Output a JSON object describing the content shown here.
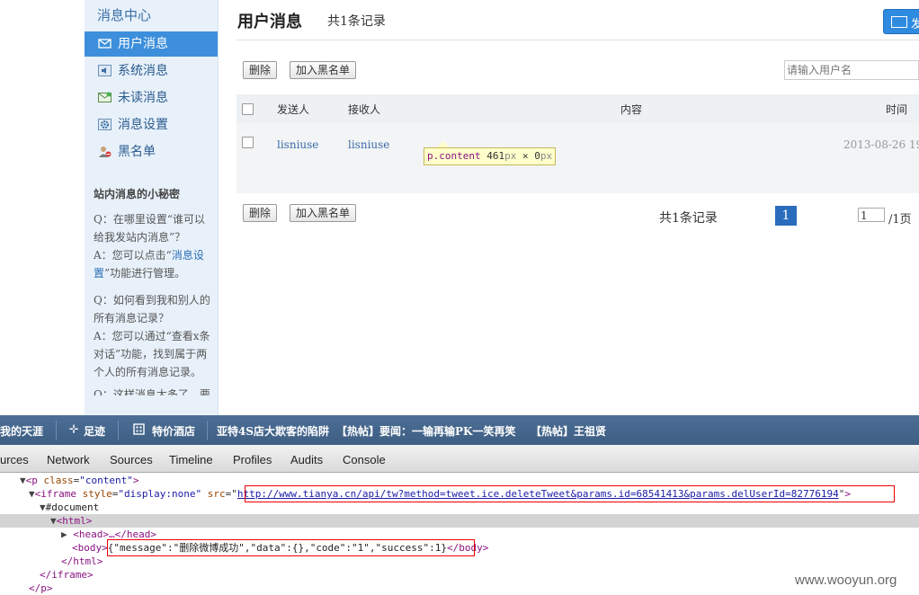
{
  "sidebar": {
    "title": "消息中心",
    "items": [
      {
        "label": "用户消息",
        "icon": "envelope-icon",
        "active": true
      },
      {
        "label": "系统消息",
        "icon": "speaker-icon"
      },
      {
        "label": "未读消息",
        "icon": "unread-mail-icon"
      },
      {
        "label": "消息设置",
        "icon": "gear-icon"
      },
      {
        "label": "黑名单",
        "icon": "user-block-icon"
      }
    ],
    "tips_title": "站内消息的小秘密",
    "tips": {
      "q1": "Q：在哪里设置“谁可以给我发站内消息”？",
      "a1_pre": "A：您可以点击“",
      "a1_link": "消息设置",
      "a1_post": "”功能进行管理。",
      "q2": "Q：如何看到我和别人的所有消息记录？",
      "a2": "A：您可以通过“查看x条对话”功能，找到属于两个人的所有消息记录。",
      "cut": "Q：这样消息太多了，要"
    }
  },
  "main": {
    "title": "用户消息",
    "count": "共1条记录",
    "compose_label": "发",
    "toolbar": {
      "delete_label": "删除",
      "blacklist_label": "加入黑名单",
      "search_placeholder": "请输入用户名"
    },
    "table": {
      "headers": {
        "sender": "发送人",
        "receiver": "接收人",
        "content": "内容",
        "time": "时间"
      },
      "rows": [
        {
          "sender": "lisniuse",
          "receiver": "lisniuse",
          "content": "",
          "time": "2013-08-26 19:"
        }
      ]
    },
    "inspect_tooltip": {
      "selector": "p.content",
      "width": "461",
      "unit_w": "px",
      "x": " × ",
      "height": "0",
      "unit_h": "px"
    },
    "pager": {
      "total": "共1条记录",
      "current": "1",
      "input": "1",
      "suffix": "/1页"
    }
  },
  "browser_bar": {
    "items": [
      "我的天涯",
      "足迹",
      "特价酒店",
      "亚特4S店大欺客的陷阱",
      "【热帖】要闻：一输再输PK一笑再笑",
      "【热帖】王祖贤"
    ]
  },
  "devtools": {
    "tabs": [
      "urces",
      "Network",
      "Sources",
      "Timeline",
      "Profiles",
      "Audits",
      "Console"
    ],
    "dom": {
      "p_tag": "<p ",
      "p_attr": "class",
      "p_val": "\"content\"",
      "iframe_open": "<iframe ",
      "iframe_style_attr": "style",
      "iframe_style_val": "\"display:none\"",
      "iframe_src_attr": "src",
      "iframe_src": "http://www.tianya.cn/api/tw?method=tweet.ice.deleteTweet&params.id=68541413&params.delUserId=82776194",
      "document": "#document",
      "html_open": "<html>",
      "head": "<head>…</head>",
      "body_open": "<body>",
      "body_text": "{\"message\":\"删除微博成功\",\"data\":{},\"code\":\"1\",\"success\":1}",
      "body_close": "</body>",
      "html_close": "</html>",
      "iframe_close": "</iframe>",
      "p_close": "</p>"
    }
  },
  "watermark": "www.wooyun.org",
  "colors": {
    "accent": "#3d8fdc",
    "toolbar": "#4d6f96",
    "highlight": "#ee0000"
  }
}
